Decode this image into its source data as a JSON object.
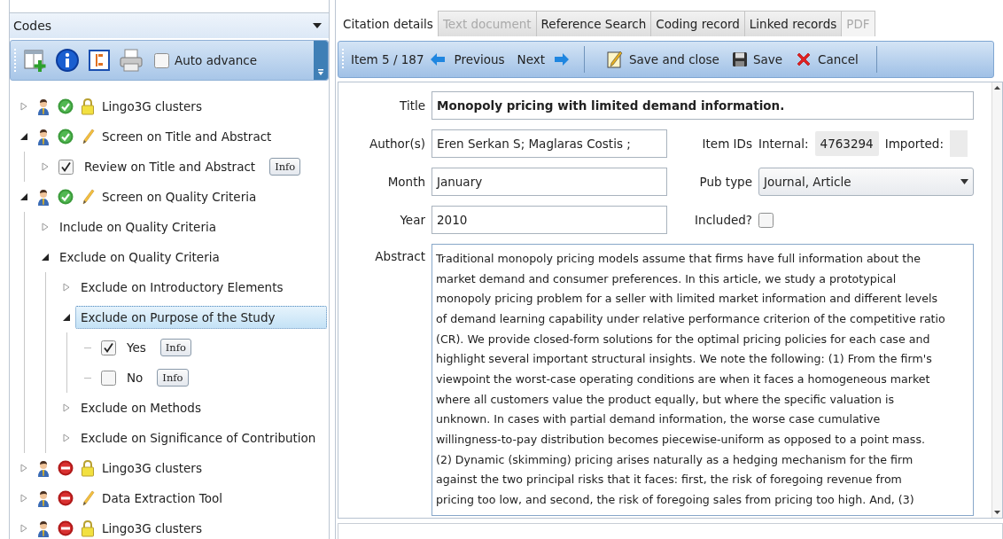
{
  "codes_panel": {
    "title": "Codes",
    "auto_advance": {
      "label": "Auto advance",
      "checked": false
    },
    "tree": [
      {
        "kind": "set",
        "label": "Lingo3G clusters",
        "complete": true,
        "locked": true,
        "expanded": false,
        "selected": false
      },
      {
        "kind": "set",
        "label": "Screen on Title and Abstract",
        "complete": true,
        "locked": false,
        "expanded": true,
        "selected": false,
        "children": [
          {
            "kind": "answer",
            "label": "Review on Title and Abstract",
            "checked": true,
            "info": "Info",
            "expanded": false,
            "selected": false
          }
        ]
      },
      {
        "kind": "set",
        "label": "Screen on Quality Criteria",
        "complete": true,
        "locked": false,
        "expanded": true,
        "selected": false,
        "children": [
          {
            "kind": "code",
            "label": "Include on Quality Criteria",
            "expanded": false,
            "selected": false
          },
          {
            "kind": "code",
            "label": "Exclude on Quality Criteria",
            "expanded": true,
            "selected": false,
            "children": [
              {
                "kind": "code",
                "label": "Exclude on Introductory Elements",
                "expanded": false,
                "selected": false
              },
              {
                "kind": "code",
                "label": "Exclude on Purpose of the Study",
                "expanded": true,
                "selected": true,
                "children": [
                  {
                    "kind": "answer",
                    "label": "Yes",
                    "checked": true,
                    "info": "Info",
                    "selected": false
                  },
                  {
                    "kind": "answer",
                    "label": "No",
                    "checked": false,
                    "info": "Info",
                    "selected": false
                  }
                ]
              },
              {
                "kind": "code",
                "label": "Exclude on Methods",
                "expanded": false,
                "selected": false
              },
              {
                "kind": "code",
                "label": "Exclude on Significance of Contribution",
                "expanded": false,
                "selected": false
              }
            ]
          }
        ]
      },
      {
        "kind": "set",
        "label": "Lingo3G clusters",
        "complete": false,
        "locked": true,
        "expanded": false,
        "selected": false
      },
      {
        "kind": "set",
        "label": "Data Extraction Tool",
        "complete": false,
        "locked": false,
        "expanded": false,
        "selected": false
      },
      {
        "kind": "set",
        "label": "Lingo3G clusters",
        "complete": false,
        "locked": true,
        "expanded": false,
        "selected": false
      }
    ]
  },
  "record": {
    "tabs": [
      {
        "label": "Citation details",
        "selected": true,
        "disabled": false
      },
      {
        "label": "Text document",
        "selected": false,
        "disabled": true
      },
      {
        "label": "Reference Search",
        "selected": false,
        "disabled": false
      },
      {
        "label": "Coding record",
        "selected": false,
        "disabled": false
      },
      {
        "label": "Linked records",
        "selected": false,
        "disabled": false
      },
      {
        "label": "PDF",
        "selected": false,
        "disabled": true
      }
    ],
    "toolbar": {
      "position": "Item 5 / 187",
      "previous": "Previous",
      "next": "Next",
      "save_close": "Save and close",
      "save": "Save",
      "cancel": "Cancel"
    },
    "fields": {
      "title_label": "Title",
      "title": "Monopoly pricing with limited demand information.",
      "authors_label": "Author(s)",
      "authors": "Eren Serkan S; Maglaras Costis ;",
      "item_ids_label": "Item IDs",
      "internal_label": "Internal:",
      "internal": "4763294",
      "imported_label": "Imported:",
      "month_label": "Month",
      "month": "January",
      "pub_type_label": "Pub type",
      "pub_type": "Journal, Article",
      "year_label": "Year",
      "year": "2010",
      "included_label": "Included?",
      "included": false,
      "abstract_label": "Abstract",
      "abstract": "Traditional monopoly pricing models assume that firms have full information about the\nmarket demand and consumer preferences. In this article, we study a prototypical\nmonopoly pricing problem for a seller with limited market information and different levels\nof demand learning capability under relative performance criterion of the competitive ratio\n(CR). We provide closed-form solutions for the optimal pricing policies for each case and\nhighlight several important structural insights. We note the following: (1) From the firm's\nviewpoint the worst-case operating conditions are when it faces a homogeneous market\nwhere all customers value the product equally, but where the specific valuation is\nunknown. In cases with partial demand information, the worse case cumulative\nwillingness-to-pay distribution becomes piecewise-uniform as opposed to a point mass.\n(2) Dynamic (skimming) pricing arises naturally as a hedging mechanism for the firm\nagainst the two principal risks that it faces: first, the risk of foregoing revenue from\npricing too low, and second, the risk of foregoing sales from pricing too high. And, (3)"
    }
  }
}
